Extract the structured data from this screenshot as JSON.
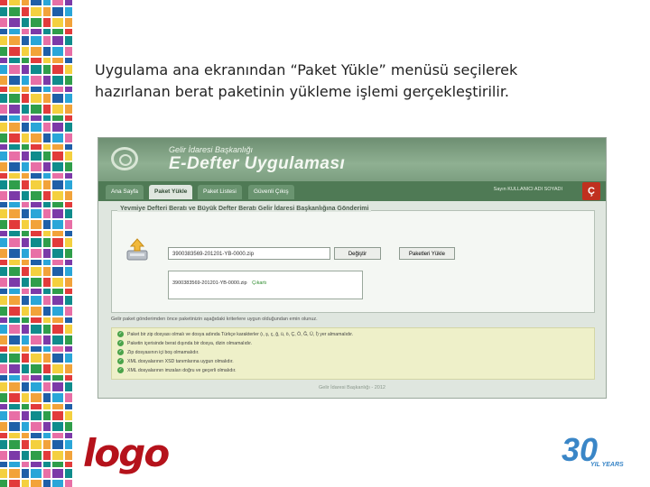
{
  "slide": {
    "line1": "Uygulama ana ekranından “Paket Yükle” menüsü seçilerek",
    "line2": "hazırlanan berat paketinin yükleme işlemi gerçekleştirilir."
  },
  "app": {
    "subtitle": "Gelir İdaresi Başkanlığı",
    "title": "E-Defter Uygulaması",
    "tabs": [
      {
        "label": "Ana Sayfa"
      },
      {
        "label": "Paket Yükle"
      },
      {
        "label": "Paket Listesi"
      },
      {
        "label": "Güvenli Çıkış"
      }
    ],
    "user_info": "Sayın KULLANICI ADI SOYADI",
    "exit_icon_label": "Ç"
  },
  "panel": {
    "title": "Yevmiye Defteri Beratı ve Büyük Defter Beratı Gelir İdaresi Başkanlığına Gönderimi",
    "file_value": "3900383569-201201-YB-0000.zip",
    "browse_label": "Değiştir",
    "upload_label": "Paketleri Yükle",
    "list_file": "3900383569-201201-YB-0000.zip",
    "list_remove": "Çıkartı"
  },
  "info_line": "Gelir paket gönderimden önce paketinizin aşağıdaki kriterlere uygun olduğundan emin olunuz.",
  "rules": [
    "Paket bir zip dosyası olmalı ve dosya adında Türkçe karakterler (ı, ş, ç, ğ, ü, ö, Ç, Ö, Ğ, Ü, İ) yer almamalıdır.",
    "Paketin içerisinde berat dışında bir dosya, dizin olmamalıdır.",
    "Zip dosyasının içi boş olmamalıdır.",
    "XML dosyalarının XSD tanımlarına uygun olmalıdır.",
    "XML dosyalarının imzaları doğru ve geçerli olmalıdır."
  ],
  "footer": "Gelir İdaresi Başkanlığı - 2012",
  "branding": {
    "company_logo": "logo",
    "anniversary_number": "30",
    "anniversary_text": "YIL YEARS"
  },
  "colors": {
    "banner": "#7c9e80",
    "nav": "#4f7a55",
    "brand_red": "#b5121b",
    "anniv_blue": "#3a86c7",
    "anniv_orange": "#f0a030"
  }
}
